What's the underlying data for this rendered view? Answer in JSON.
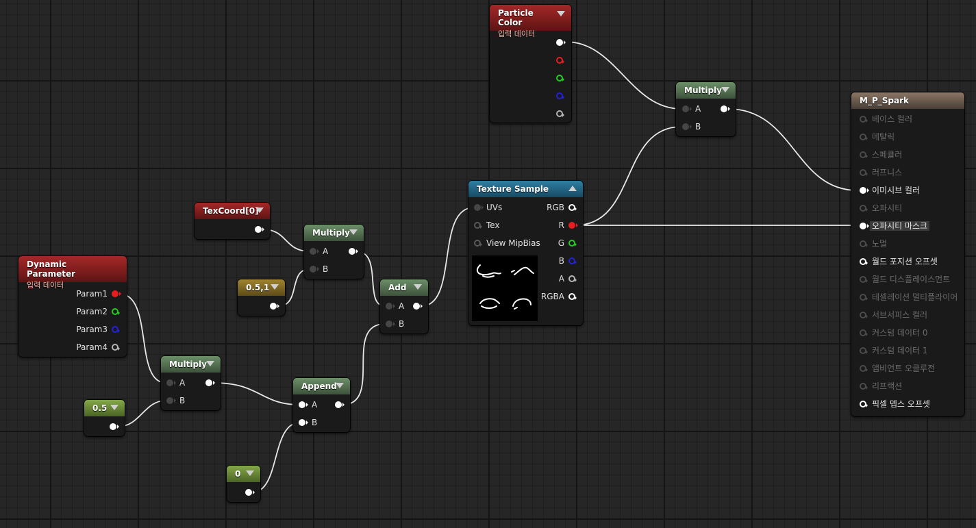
{
  "nodes": {
    "particle_color": {
      "title": "Particle Color",
      "subtitle": "입력 데이터"
    },
    "dynamic_parameter": {
      "title": "Dynamic Parameter",
      "subtitle": "입력 데이터",
      "outputs": [
        "Param1",
        "Param2",
        "Param3",
        "Param4"
      ]
    },
    "texcoord": {
      "title": "TexCoord[0]"
    },
    "const_05_1": {
      "title": "0.5,1"
    },
    "const_05": {
      "title": "0.5"
    },
    "const_0": {
      "title": "0"
    },
    "multiply_uv": {
      "title": "Multiply",
      "pin_a": "A",
      "pin_b": "B"
    },
    "multiply_param": {
      "title": "Multiply",
      "pin_a": "A",
      "pin_b": "B"
    },
    "append": {
      "title": "Append",
      "pin_a": "A",
      "pin_b": "B"
    },
    "add": {
      "title": "Add",
      "pin_a": "A",
      "pin_b": "B"
    },
    "multiply_color": {
      "title": "Multiply",
      "pin_a": "A",
      "pin_b": "B"
    },
    "texture_sample": {
      "title": "Texture Sample",
      "inputs": [
        "UVs",
        "Tex",
        "View MipBias"
      ],
      "outputs": [
        "RGB",
        "R",
        "G",
        "B",
        "A",
        "RGBA"
      ]
    },
    "material_result": {
      "title": "M_P_Spark",
      "inputs": [
        "베이스 컬러",
        "메탈릭",
        "스페큘러",
        "러프니스",
        "이미시브 컬러",
        "오파시티",
        "오파시티 마스크",
        "노멀",
        "월드 포지션 오프셋",
        "월드 디스플레이스먼트",
        "테셀레이션 멀티플라이어",
        "서브서피스 컬러",
        "커스텀 데이터 0",
        "커스텀 데이터 1",
        "앰비언트 오클루전",
        "리프랙션",
        "픽셀 뎁스 오프셋"
      ]
    }
  },
  "colors": {
    "wire": "#e8e8e8",
    "pin_red": "#e81e1e",
    "pin_green": "#22cc22",
    "pin_blue": "#2222d8"
  }
}
